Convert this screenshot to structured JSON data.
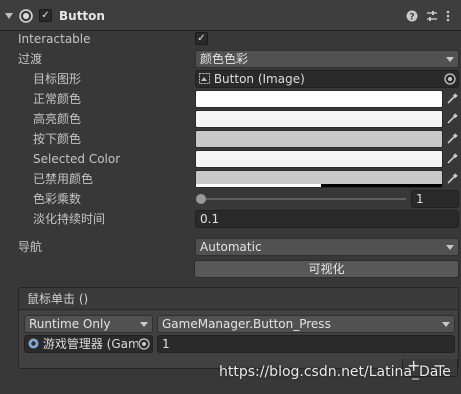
{
  "header": {
    "component_name": "Button",
    "enabled_check": "✓"
  },
  "props": {
    "interactable": {
      "label": "Interactable",
      "check": "✓"
    },
    "transition": {
      "label": "过渡",
      "value": "颜色色彩"
    },
    "target_graphic": {
      "label": "目标图形",
      "value": "Button (Image)"
    },
    "normal_color": {
      "label": "正常颜色"
    },
    "highlighted_color": {
      "label": "高亮颜色"
    },
    "pressed_color": {
      "label": "按下颜色"
    },
    "selected_color": {
      "label": "Selected Color"
    },
    "disabled_color": {
      "label": "已禁用颜色"
    },
    "color_multiplier": {
      "label": "色彩乘数",
      "value": "1",
      "fraction": 0.0
    },
    "fade_duration": {
      "label": "淡化持续时间",
      "value": "0.1"
    },
    "navigation": {
      "label": "导航",
      "value": "Automatic"
    },
    "visualize_label": "可视化"
  },
  "colors": {
    "normal": "#ffffff",
    "highlighted": "#f5f5f5",
    "pressed": "#c8c8c8",
    "selected": "#f5f5f5",
    "disabled": "#c8c8c8"
  },
  "event": {
    "title": "鼠标单击 ()",
    "runtime": "Runtime Only",
    "function": "GameManager.Button_Press",
    "object": "游戏管理器 (Gam",
    "argument": "1",
    "add": "+",
    "remove": "−"
  },
  "watermark": "https://blog.csdn.net/Latina_Dale"
}
